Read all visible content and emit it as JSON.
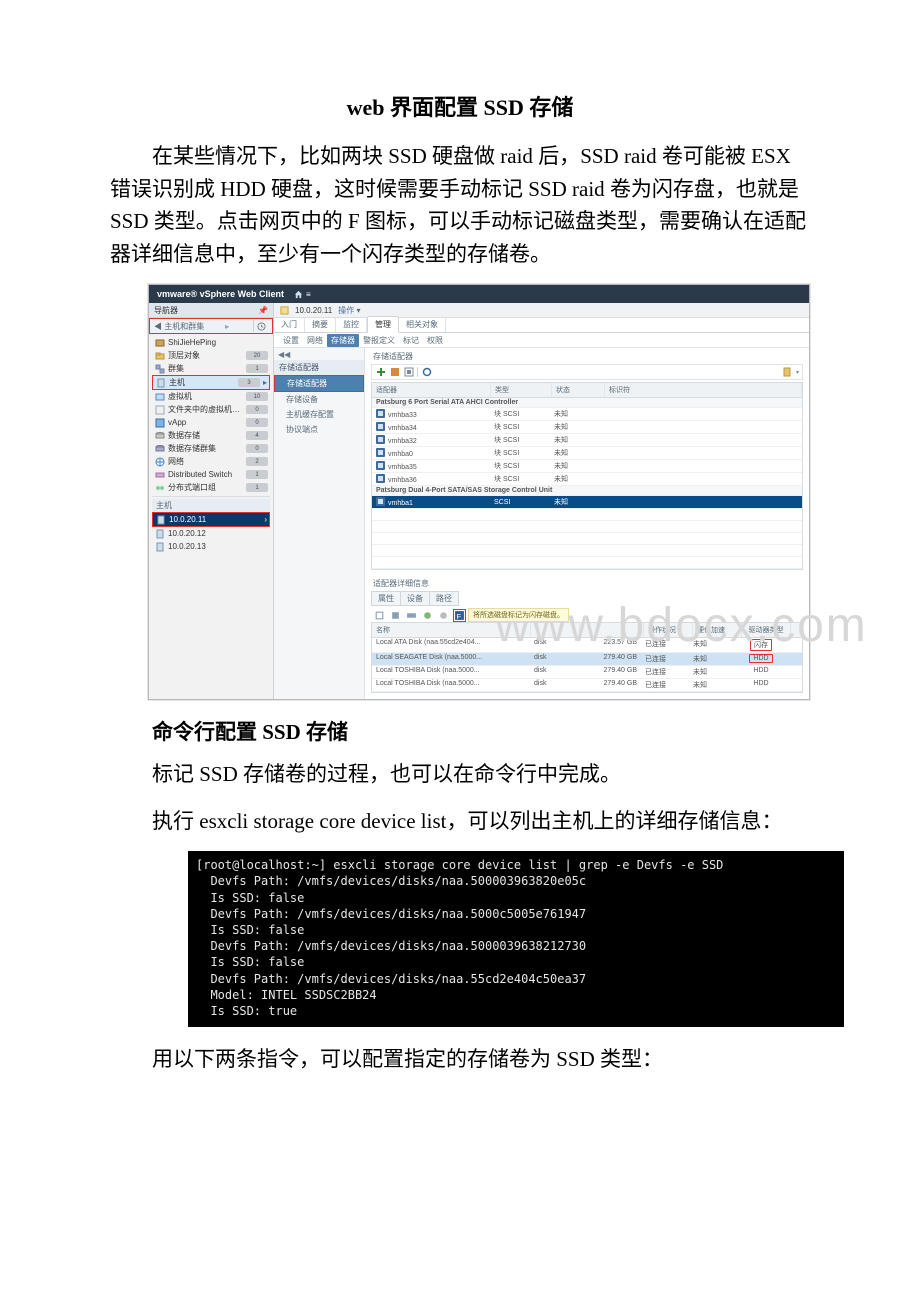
{
  "doc": {
    "title_pre": "web ",
    "title_mid_cn": "界面配置",
    "title_ssd": " SSD ",
    "title_post_cn": "存储",
    "para1_a": "在某些情况下，比如两块 ",
    "para1_b": "SSD ",
    "para1_c": "硬盘做 ",
    "para1_d": "raid ",
    "para1_e": "后，",
    "para1_f": "SSD raid ",
    "para1_g": "卷可能被 ",
    "para1_h": "ESX ",
    "para1_i": "错误识别成 ",
    "para1_j": "HDD ",
    "para1_k": "硬盘，这时候需要手动标记 ",
    "para1_l": "SSD raid ",
    "para1_m": "卷为闪存盘，也就是 ",
    "para1_n": "SSD ",
    "para1_o": "类型。点击网页中的 ",
    "para1_p": "F ",
    "para1_q": "图标，可以手动标记磁盘类型，需要确认在适配器详细信息中，至少有一个闪存类型的存储卷。",
    "sub2_a": "命令行配置 ",
    "sub2_b": "SSD ",
    "sub2_c": "存储",
    "para2_a": "标记 ",
    "para2_b": "SSD ",
    "para2_c": "存储卷的过程，也可以在命令行中完成。",
    "para3_a": "执行 ",
    "para3_b": "esxcli storage core device list",
    "para3_c": "，可以列出主机上的详细存储信息：",
    "para4": "用以下两条指令，可以配置指定的存储卷为 SSD 类型："
  },
  "vsphere": {
    "brand": "vmware® vSphere Web Client",
    "home_icon": "home-icon",
    "nav": {
      "title": "导航器",
      "back": "◀ 主机和群集",
      "root": "ShiJieHePing",
      "items": [
        {
          "icon": "folder",
          "label": "顶层对象",
          "badge": "20"
        },
        {
          "icon": "cluster",
          "label": "群集",
          "badge": "1"
        },
        {
          "icon": "host",
          "label": "主机",
          "badge": "3",
          "active": true
        },
        {
          "icon": "vm",
          "label": "虚拟机",
          "badge": "10"
        },
        {
          "icon": "template",
          "label": "文件夹中的虚拟机模板",
          "badge": "0"
        },
        {
          "icon": "vapp",
          "label": "vApp",
          "badge": "0"
        },
        {
          "icon": "datastore",
          "label": "数据存储",
          "badge": "4"
        },
        {
          "icon": "dscluster",
          "label": "数据存储群集",
          "badge": "0"
        },
        {
          "icon": "network",
          "label": "网络",
          "badge": "2"
        },
        {
          "icon": "dvs",
          "label": "Distributed Switch",
          "badge": "1"
        },
        {
          "icon": "portgroup",
          "label": "分布式端口组",
          "badge": "1"
        }
      ],
      "hosts_header": "主机",
      "hosts": [
        {
          "label": "10.0.20.11",
          "selected": true
        },
        {
          "label": "10.0.20.12"
        },
        {
          "label": "10.0.20.13"
        }
      ]
    },
    "crumb": {
      "host": "10.0.20.11",
      "actions": "操作 ▾"
    },
    "tabs": [
      "入门",
      "摘要",
      "监控",
      "管理",
      "相关对象"
    ],
    "tab_current": 3,
    "subtabs": [
      "设置",
      "网络",
      "存储器",
      "警报定义",
      "标记",
      "权限"
    ],
    "subtab_current": 2,
    "left2": {
      "title": "存储适配器",
      "items": [
        "存储适配器",
        "存储设备",
        "主机缓存配置",
        "协议端点"
      ],
      "current": 0
    },
    "adapters": {
      "title": "存储适配器",
      "headers": [
        "适配器",
        "类型",
        "状态",
        "标识符"
      ],
      "groups": [
        {
          "name": "Patsburg 6 Port Serial ATA AHCI Controller",
          "rows": [
            {
              "a": "vmhba33",
              "t": "块 SCSI",
              "s": "未知"
            },
            {
              "a": "vmhba34",
              "t": "块 SCSI",
              "s": "未知"
            },
            {
              "a": "vmhba32",
              "t": "块 SCSI",
              "s": "未知"
            },
            {
              "a": "vmhba0",
              "t": "块 SCSI",
              "s": "未知"
            },
            {
              "a": "vmhba35",
              "t": "块 SCSI",
              "s": "未知"
            },
            {
              "a": "vmhba36",
              "t": "块 SCSI",
              "s": "未知"
            }
          ]
        },
        {
          "name": "Patsburg Dual 4-Port SATA/SAS Storage Control Unit",
          "rows": [
            {
              "a": "vmhba1",
              "t": "SCSI",
              "s": "未知",
              "sel": true
            }
          ]
        }
      ]
    },
    "details": {
      "title": "适配器详细信息",
      "tabs": [
        "属性",
        "设备",
        "路径"
      ],
      "tooltip": "将所选磁盘标记为闪存磁盘。",
      "headers": [
        "名称",
        "—",
        "—",
        "操作状况",
        "硬件加速",
        "驱动器类型"
      ],
      "h_name": "名称",
      "h_type": "",
      "h_size": "",
      "h_op": "操作状况",
      "h_acc": "硬件加速",
      "h_dtype": "驱动器类型",
      "rows": [
        {
          "n": "Local ATA Disk (naa.55cd2e404...",
          "t": "disk",
          "sz": "223.57 GB",
          "op": "已连接",
          "acc": "未知",
          "dt": "闪存",
          "flash": true
        },
        {
          "n": "Local SEAGATE Disk (naa.5000...",
          "t": "disk",
          "sz": "279.40 GB",
          "op": "已连接",
          "acc": "未知",
          "dt": "HDD",
          "sel": true,
          "hdd_box": true
        },
        {
          "n": "Local TOSHIBA Disk (naa.5000...",
          "t": "disk",
          "sz": "279.40 GB",
          "op": "已连接",
          "acc": "未知",
          "dt": "HDD"
        },
        {
          "n": "Local TOSHIBA Disk (naa.5000...",
          "t": "disk",
          "sz": "279.40 GB",
          "op": "已连接",
          "acc": "未知",
          "dt": "HDD"
        }
      ]
    },
    "watermark": "www.bdocx.com"
  },
  "terminal": {
    "prompt": "[root@localhost:~] ",
    "cmd": "esxcli storage core device list | grep -e Devfs -e SSD",
    "lines": [
      "  Devfs Path: /vmfs/devices/disks/naa.500003963820e05c",
      "  Is SSD: false",
      "  Devfs Path: /vmfs/devices/disks/naa.5000c5005e761947",
      "  Is SSD: false",
      "  Devfs Path: /vmfs/devices/disks/naa.5000039638212730",
      "  Is SSD: false",
      "  Devfs Path: /vmfs/devices/disks/naa.55cd2e404c50ea37",
      "  Model: INTEL SSDSC2BB24",
      "  Is SSD: true"
    ]
  }
}
